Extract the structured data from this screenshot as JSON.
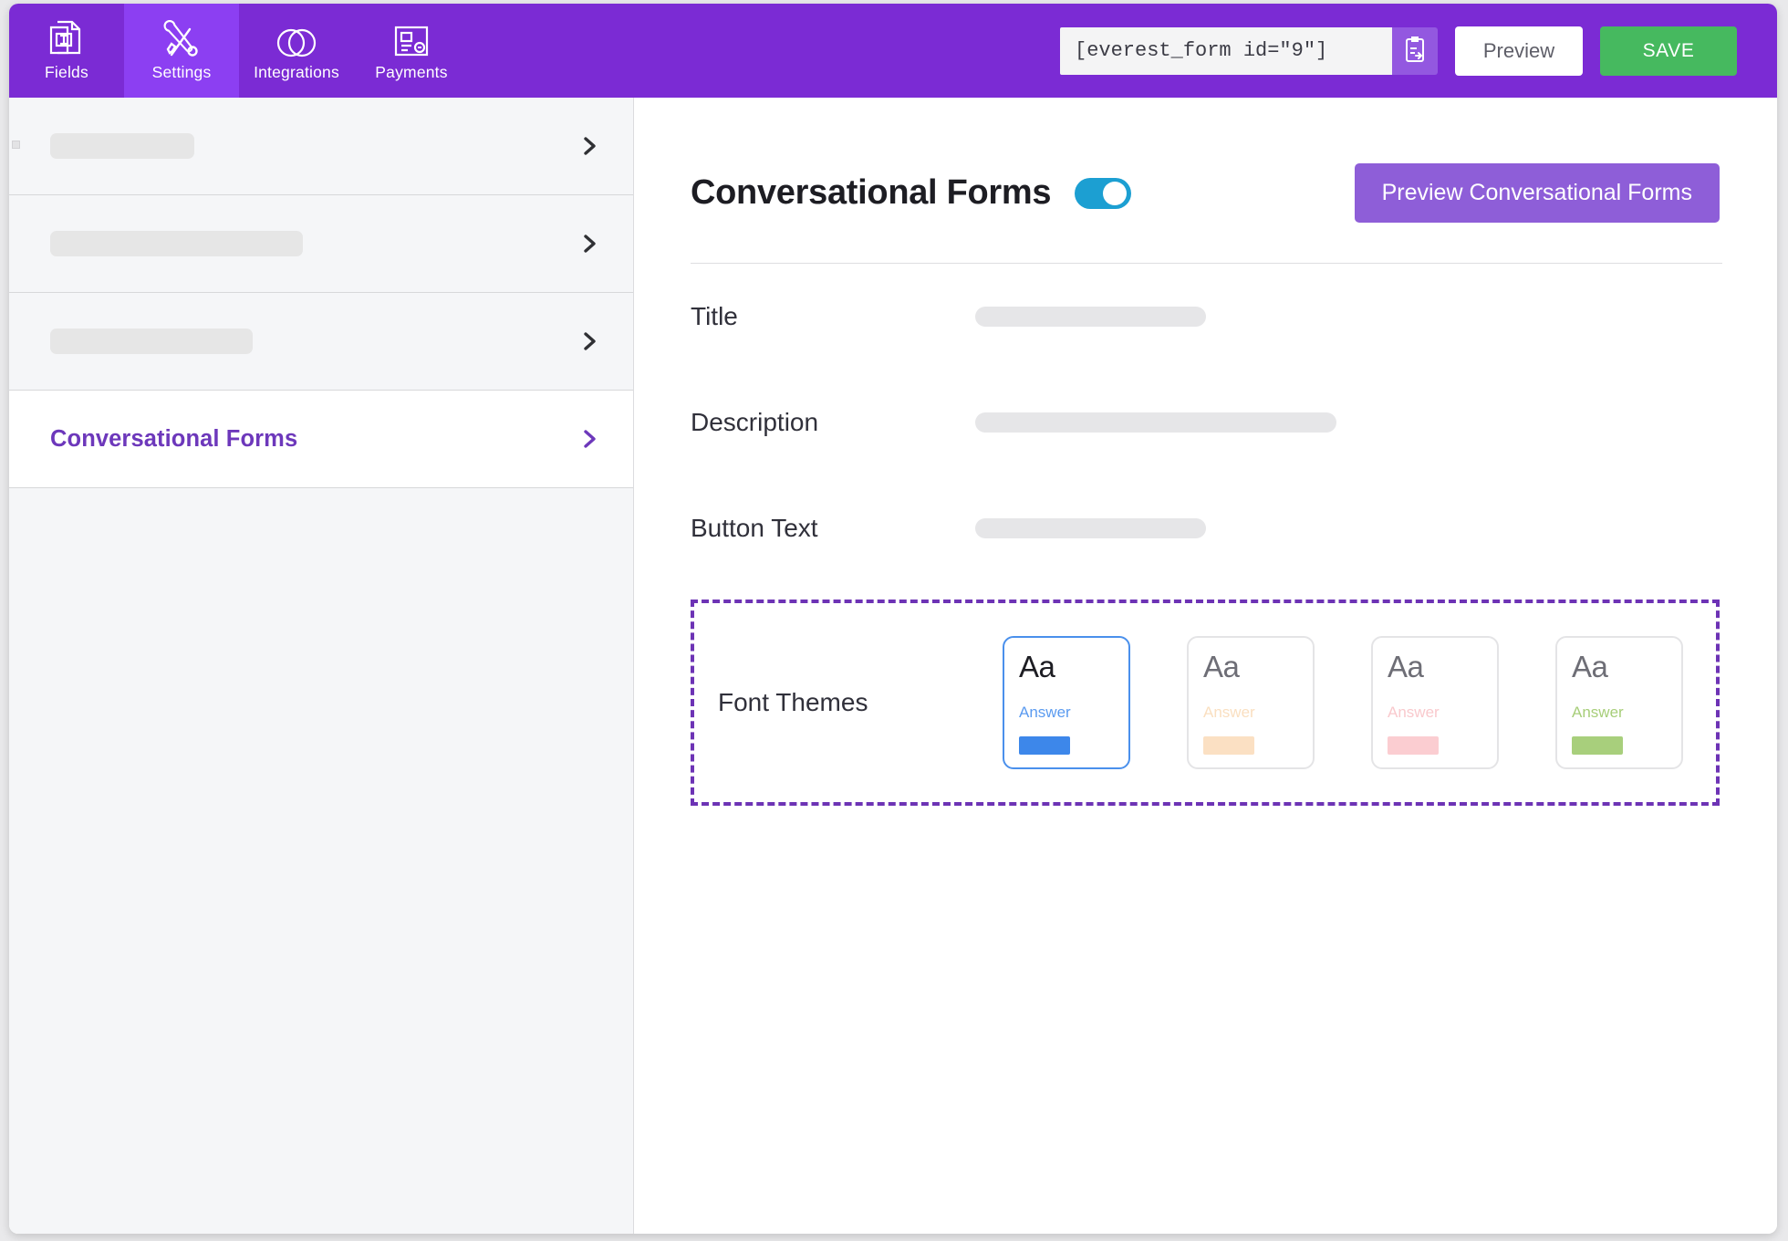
{
  "topbar": {
    "accent_color": "#7b2bd4",
    "active_tab_color": "#8c3ff2",
    "tabs": [
      {
        "label": "Fields",
        "icon": "form-fields-icon",
        "active": false
      },
      {
        "label": "Settings",
        "icon": "tools-icon",
        "active": true
      },
      {
        "label": "Integrations",
        "icon": "venn-circles-icon",
        "active": false
      },
      {
        "label": "Payments",
        "icon": "payment-card-icon",
        "active": false
      }
    ],
    "shortcode": {
      "value": "[everest_form id=\"9\"]",
      "placeholder": "[everest_form id=\"9\"]",
      "copy_icon": "clipboard-copy-icon"
    },
    "preview_label": "Preview",
    "save_label": "SAVE",
    "save_color": "#46b95f"
  },
  "sidebar": {
    "items": [
      {
        "label": "",
        "redacted": true,
        "redacted_width": 158,
        "active": false,
        "chevron": "chevron-right-icon"
      },
      {
        "label": "",
        "redacted": true,
        "redacted_width": 277,
        "active": false,
        "chevron": "chevron-right-icon"
      },
      {
        "label": "",
        "redacted": true,
        "redacted_width": 222,
        "active": false,
        "chevron": "chevron-right-icon"
      },
      {
        "label": "Conversational Forms",
        "redacted": false,
        "active": true,
        "chevron": "chevron-right-icon"
      }
    ],
    "active_label_color": "#6d38bb"
  },
  "main": {
    "title": "Conversational Forms",
    "toggle": {
      "state": "on",
      "color": "#1c9fd2"
    },
    "preview_cf_label": "Preview Conversational Forms",
    "preview_cf_color": "#8e5ed8",
    "rows": [
      {
        "label": "Title",
        "value": "",
        "redacted": true,
        "field_width": 253
      },
      {
        "label": "Description",
        "value": "",
        "redacted": true,
        "field_width": 396
      },
      {
        "label": "Button Text",
        "value": "",
        "redacted": true,
        "field_width": 253
      }
    ],
    "font_themes": {
      "label": "Font Themes",
      "highlight_color": "#6d33b5",
      "cards": [
        {
          "sample": "Aa",
          "answer": "Answer",
          "answer_color": "#5b9bf0",
          "bar_color": "#3d87ea",
          "border_color": "#4a90ec",
          "selected": true
        },
        {
          "sample": "Aa",
          "answer": "Answer",
          "answer_color": "#fadfc0",
          "bar_color": "#fbe0c3",
          "border_color": "#e4e4e6",
          "selected": false
        },
        {
          "sample": "Aa",
          "answer": "Answer",
          "answer_color": "#f9c9cd",
          "bar_color": "#fbcdd1",
          "border_color": "#e4e4e6",
          "selected": false
        },
        {
          "sample": "Aa",
          "answer": "Answer",
          "answer_color": "#a7ce79",
          "bar_color": "#a8cf7c",
          "border_color": "#e4e4e6",
          "selected": false
        }
      ]
    }
  }
}
